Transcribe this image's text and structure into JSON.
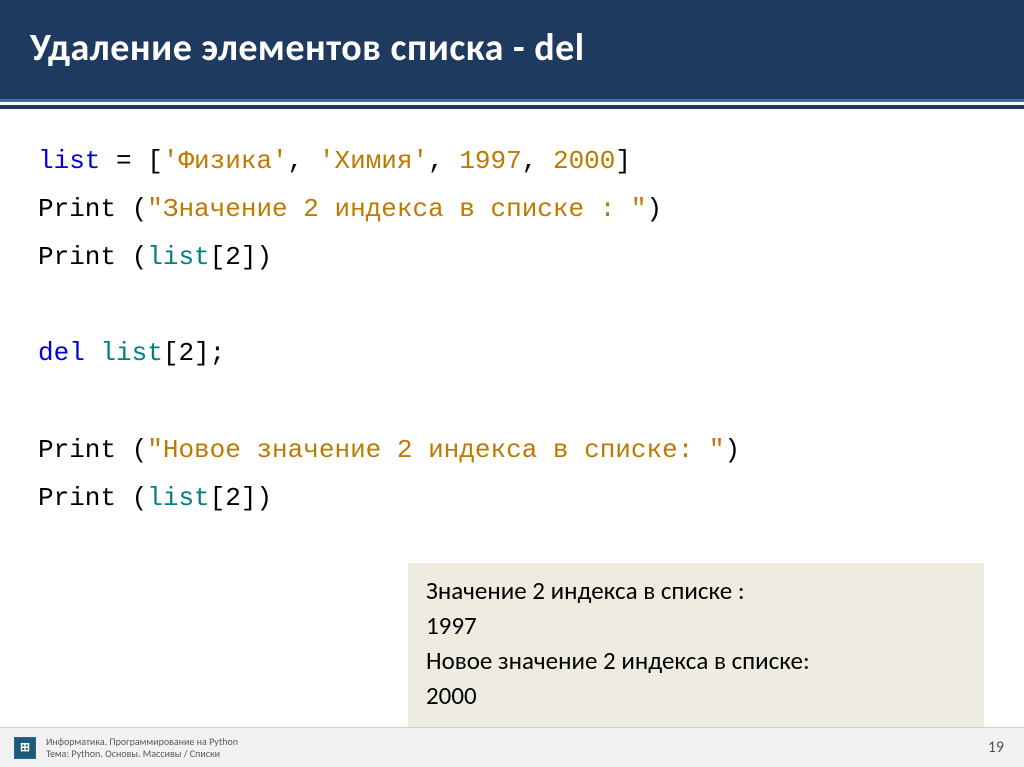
{
  "header": {
    "title": "Удаление элементов списка - del"
  },
  "code": {
    "line1": {
      "kw": "list",
      "eq": " = [",
      "str1": "'Физика'",
      "comma1": ", ",
      "str2": "'Химия'",
      "comma2": ", ",
      "num1": "1997",
      "comma3": ", ",
      "num2": "2000",
      "close": "]"
    },
    "line2": {
      "fn": "Print",
      "open": " (",
      "str": "\"Значение 2 индекса в списке : \"",
      "close": ")"
    },
    "line3": {
      "fn": "Print",
      "open": " (",
      "ident": "list",
      "idx": "[2])"
    },
    "line4": {
      "kw": "del",
      "sp": " ",
      "ident": "list",
      "idx": "[2];"
    },
    "line5": {
      "fn": "Print",
      "open": " (",
      "str": "\"Новое значение 2 индекса в списке: \"",
      "close": ")"
    },
    "line6": {
      "fn": "Print",
      "open": " (",
      "ident": "list",
      "idx": "[2])"
    }
  },
  "output": {
    "l1": "Значение 2 индекса в списке :",
    "l2": "1997",
    "l3": "Новое значение 2 индекса в списке:",
    "l4": "2000"
  },
  "footer": {
    "line1": "Информатика. Программирование на Python",
    "line2": "Тема: Python. Основы. Массивы / Списки",
    "page": "19"
  }
}
